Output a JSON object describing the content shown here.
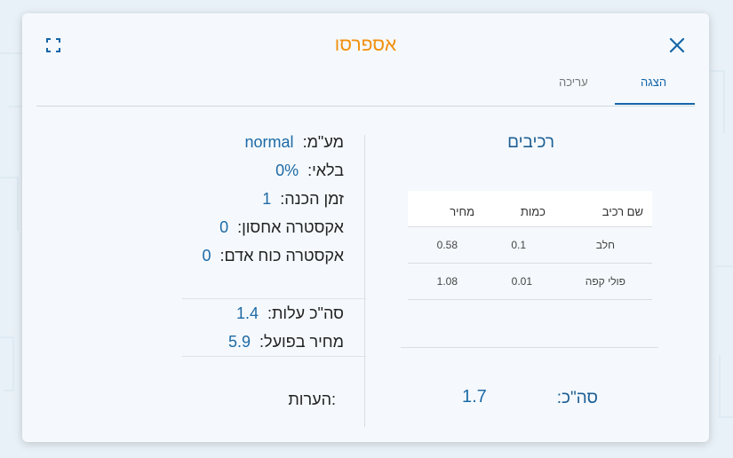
{
  "dialog": {
    "title": "אספרסו",
    "close_icon": "close-icon",
    "expand_icon": "expand-icon"
  },
  "tabs": [
    {
      "label": "הצגה",
      "active": true
    },
    {
      "label": "עריכה",
      "active": false
    }
  ],
  "details": {
    "unit_label": "מע\"מ:",
    "unit_value": "normal",
    "waste_label": "בלאי:",
    "waste_value": "0%",
    "prep_label": "זמן הכנה:",
    "prep_value": "1",
    "storage_label": "אקסטרה אחסון:",
    "storage_value": "0",
    "labor_label": "אקסטרה כוח אדם:",
    "labor_value": "0",
    "cost_label": "סה\"כ עלות:",
    "cost_value": "1.4",
    "actual_label": "מחיר בפועל:",
    "actual_value": "5.9",
    "notes_label": "הערות:"
  },
  "ingredients": {
    "title": "רכיבים",
    "columns": [
      "שם רכיב",
      "כמות",
      "מחיר"
    ],
    "rows": [
      {
        "name": "חלב",
        "qty": "0.1",
        "price": "0.58"
      },
      {
        "name": "פולי קפה",
        "qty": "0.01",
        "price": "1.08"
      }
    ],
    "total_label": "סה\"כ:",
    "total_value": "1.7"
  },
  "colors": {
    "accent": "#f2900e",
    "primary": "#1565a8",
    "value": "#1d6aa6"
  }
}
